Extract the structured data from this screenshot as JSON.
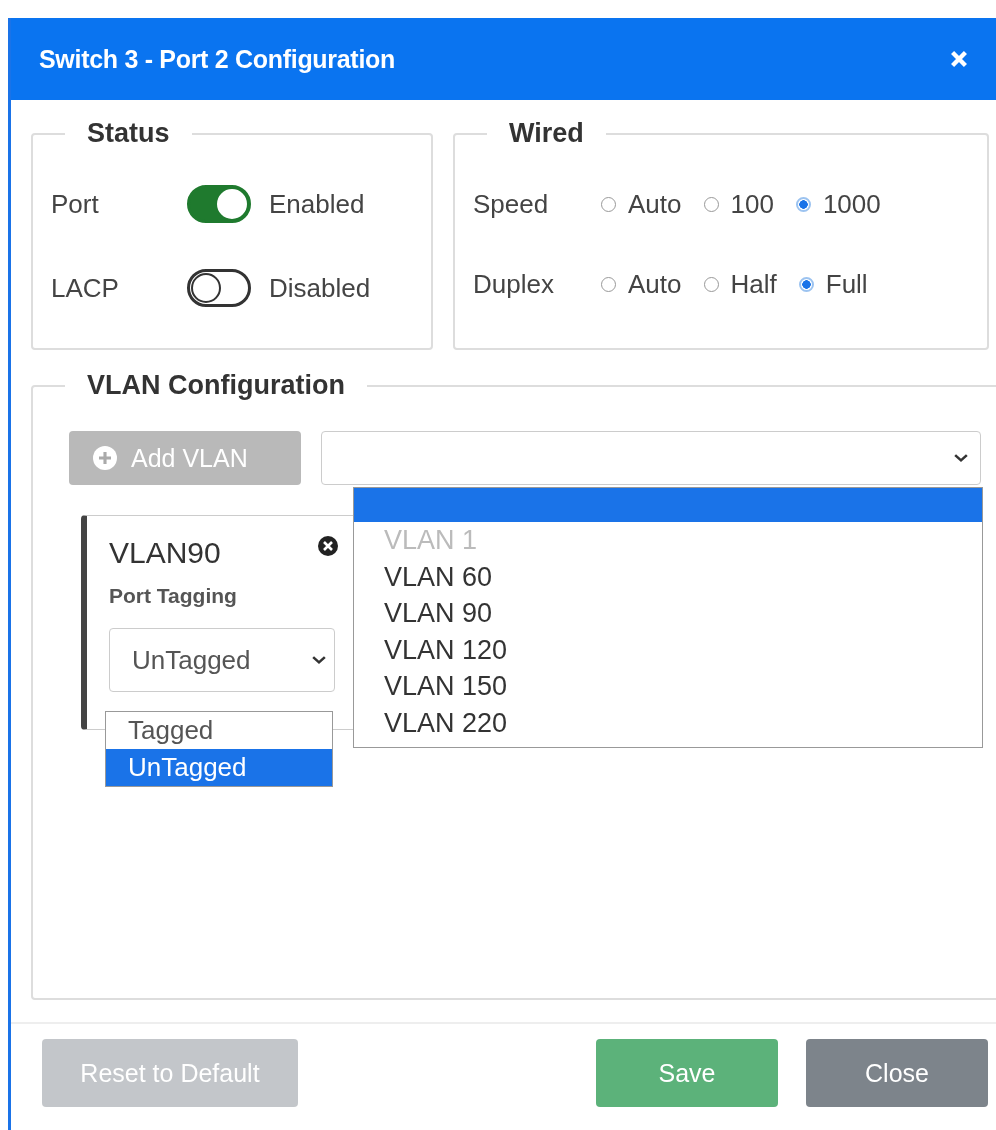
{
  "window": {
    "title": "Switch 3 - Port 2 Configuration"
  },
  "status": {
    "legend": "Status",
    "toggles": [
      {
        "label": "Port",
        "on": true,
        "state_text": "Enabled"
      },
      {
        "label": "LACP",
        "on": false,
        "state_text": "Disabled"
      }
    ]
  },
  "wired": {
    "legend": "Wired",
    "groups": [
      {
        "label": "Speed",
        "options": [
          {
            "label": "Auto",
            "selected": false
          },
          {
            "label": "100",
            "selected": false
          },
          {
            "label": "1000",
            "selected": true
          }
        ]
      },
      {
        "label": "Duplex",
        "options": [
          {
            "label": "Auto",
            "selected": false
          },
          {
            "label": "Half",
            "selected": false
          },
          {
            "label": "Full",
            "selected": true
          }
        ]
      }
    ]
  },
  "vlan_configuration": {
    "legend": "VLAN Configuration",
    "add_button": {
      "label": "Add VLAN",
      "disabled": true
    },
    "vlan_dropdown": {
      "blank_option_highlighted": true,
      "options": [
        {
          "label": "VLAN 1",
          "disabled": true
        },
        {
          "label": "VLAN 60",
          "disabled": false
        },
        {
          "label": "VLAN 90",
          "disabled": false
        },
        {
          "label": "VLAN 120",
          "disabled": false
        },
        {
          "label": "VLAN 150",
          "disabled": false
        },
        {
          "label": "VLAN 220",
          "disabled": false
        }
      ]
    },
    "vlan_card": {
      "name": "VLAN90",
      "tagging_label": "Port Tagging",
      "tagging_value": "UnTagged",
      "tagging_options": [
        {
          "label": "Tagged",
          "selected": false
        },
        {
          "label": "UnTagged",
          "selected": true
        }
      ]
    }
  },
  "footer_buttons": [
    {
      "label": "Reset to Default",
      "kind": "reset",
      "disabled": true
    },
    {
      "label": "Save",
      "kind": "save",
      "disabled": false
    },
    {
      "label": "Close",
      "kind": "close",
      "disabled": false
    }
  ]
}
